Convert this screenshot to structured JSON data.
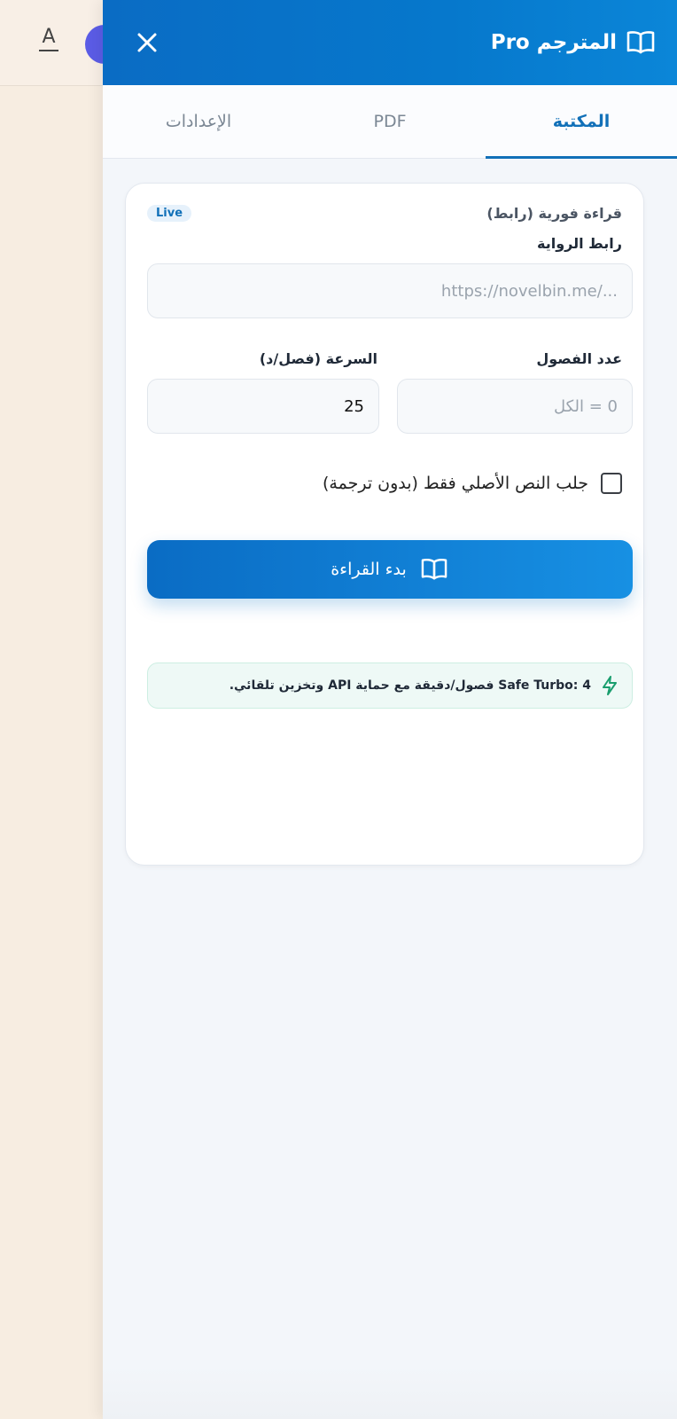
{
  "background_page": {
    "font_icon_letter": "A",
    "avatar_color": "#5b5ce6"
  },
  "panel": {
    "title": "المترجم Pro",
    "title_icon": "open-book-icon",
    "close_icon": "close-icon",
    "header_color": "#0a6cc4"
  },
  "tabs": [
    {
      "label": "المكتبة",
      "active": true
    },
    {
      "label": "PDF",
      "active": false
    },
    {
      "label": "الإعدادات",
      "active": false
    }
  ],
  "live_reading": {
    "section_title": "قراءة فورية (رابط)",
    "badge": "Live",
    "url_label": "رابط الرواية",
    "url_placeholder": "https://novelbin.me/...",
    "chapters_label": "عدد الفصول",
    "chapters_placeholder": "0 = الكل",
    "speed_label": "السرعة (فصل/د)",
    "speed_value": "25",
    "original_only_label": "جلب النص الأصلي فقط (بدون ترجمة)",
    "original_only_checked": false,
    "start_button_label": "بدء القراءة",
    "start_button_icon": "open-book-icon",
    "info_icon": "lightning-icon",
    "info_text": "Safe Turbo: 4 فصول/دقيقة مع حماية API وتخزين تلقائي."
  }
}
